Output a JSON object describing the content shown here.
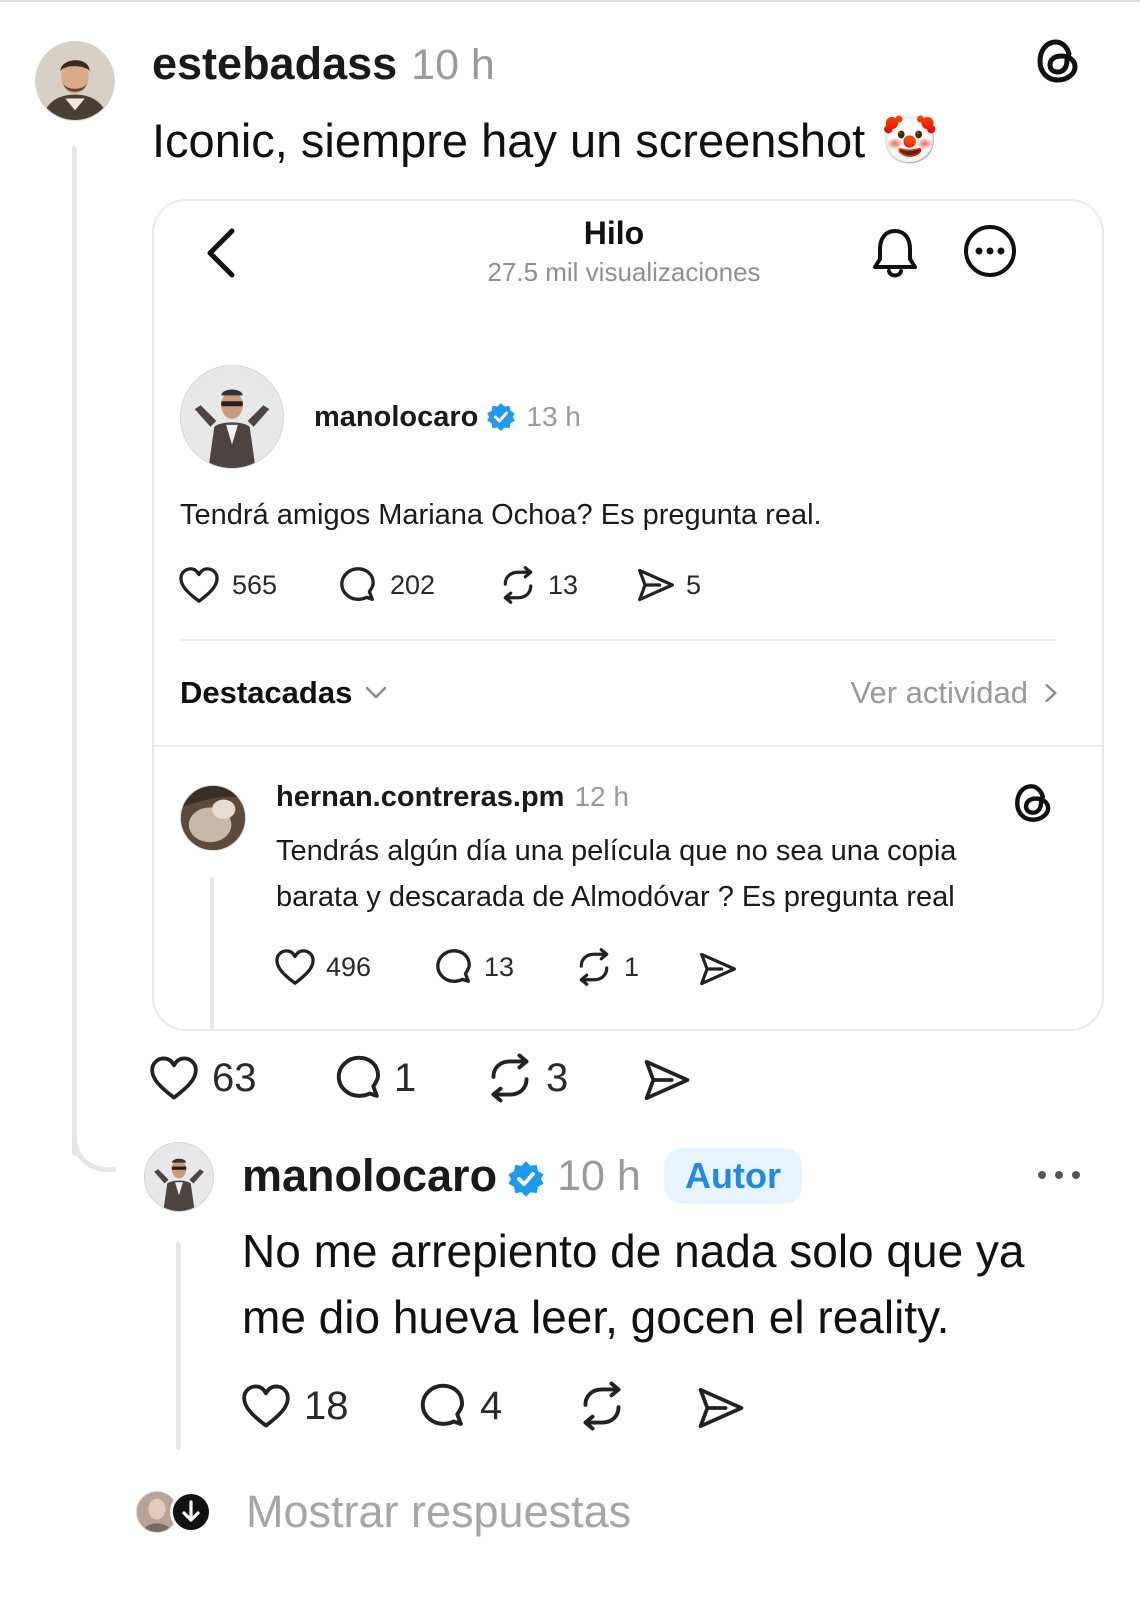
{
  "post": {
    "username": "estebadass",
    "time": "10 h",
    "text": "Iconic, siempre hay un screenshot",
    "emoji": "🤡",
    "likes": "63",
    "replies": "1",
    "reposts": "3"
  },
  "embed": {
    "header_title": "Hilo",
    "header_subtitle": "27.5 mil visualizaciones",
    "original": {
      "username": "manolocaro",
      "time": "13 h",
      "text": "Tendrá amigos Mariana Ochoa? Es pregunta real.",
      "likes": "565",
      "replies": "202",
      "reposts": "13",
      "shares": "5"
    },
    "sort_label": "Destacadas",
    "activity_link": "Ver actividad",
    "reply": {
      "username": "hernan.contreras.pm",
      "time": "12 h",
      "text_line1": "Tendrás algún día una película que no sea una copia",
      "text_line2": "barata y descarada de Almodóvar ? Es pregunta real",
      "likes": "496",
      "replies": "13",
      "reposts": "1"
    }
  },
  "author_reply": {
    "username": "manolocaro",
    "time": "10 h",
    "badge": "Autor",
    "text_line1": "No me arrepiento de nada solo que ya",
    "text_line2": "me dio hueva leer, gocen el reality.",
    "likes": "18",
    "replies": "4"
  },
  "show_replies": "Mostrar respuestas",
  "colors": {
    "verified": "#1d9bf0",
    "badge_text": "#1f8be6",
    "badge_bg": "#e8f3fe",
    "muted": "#9a9a9a"
  },
  "icons": [
    "threads-logo-icon",
    "back-icon",
    "bell-icon",
    "more-circle-icon",
    "heart-icon",
    "comment-icon",
    "repost-icon",
    "share-icon",
    "verified-icon",
    "chevron-down-icon",
    "chevron-right-icon",
    "more-dots-icon",
    "arrow-down-icon"
  ]
}
